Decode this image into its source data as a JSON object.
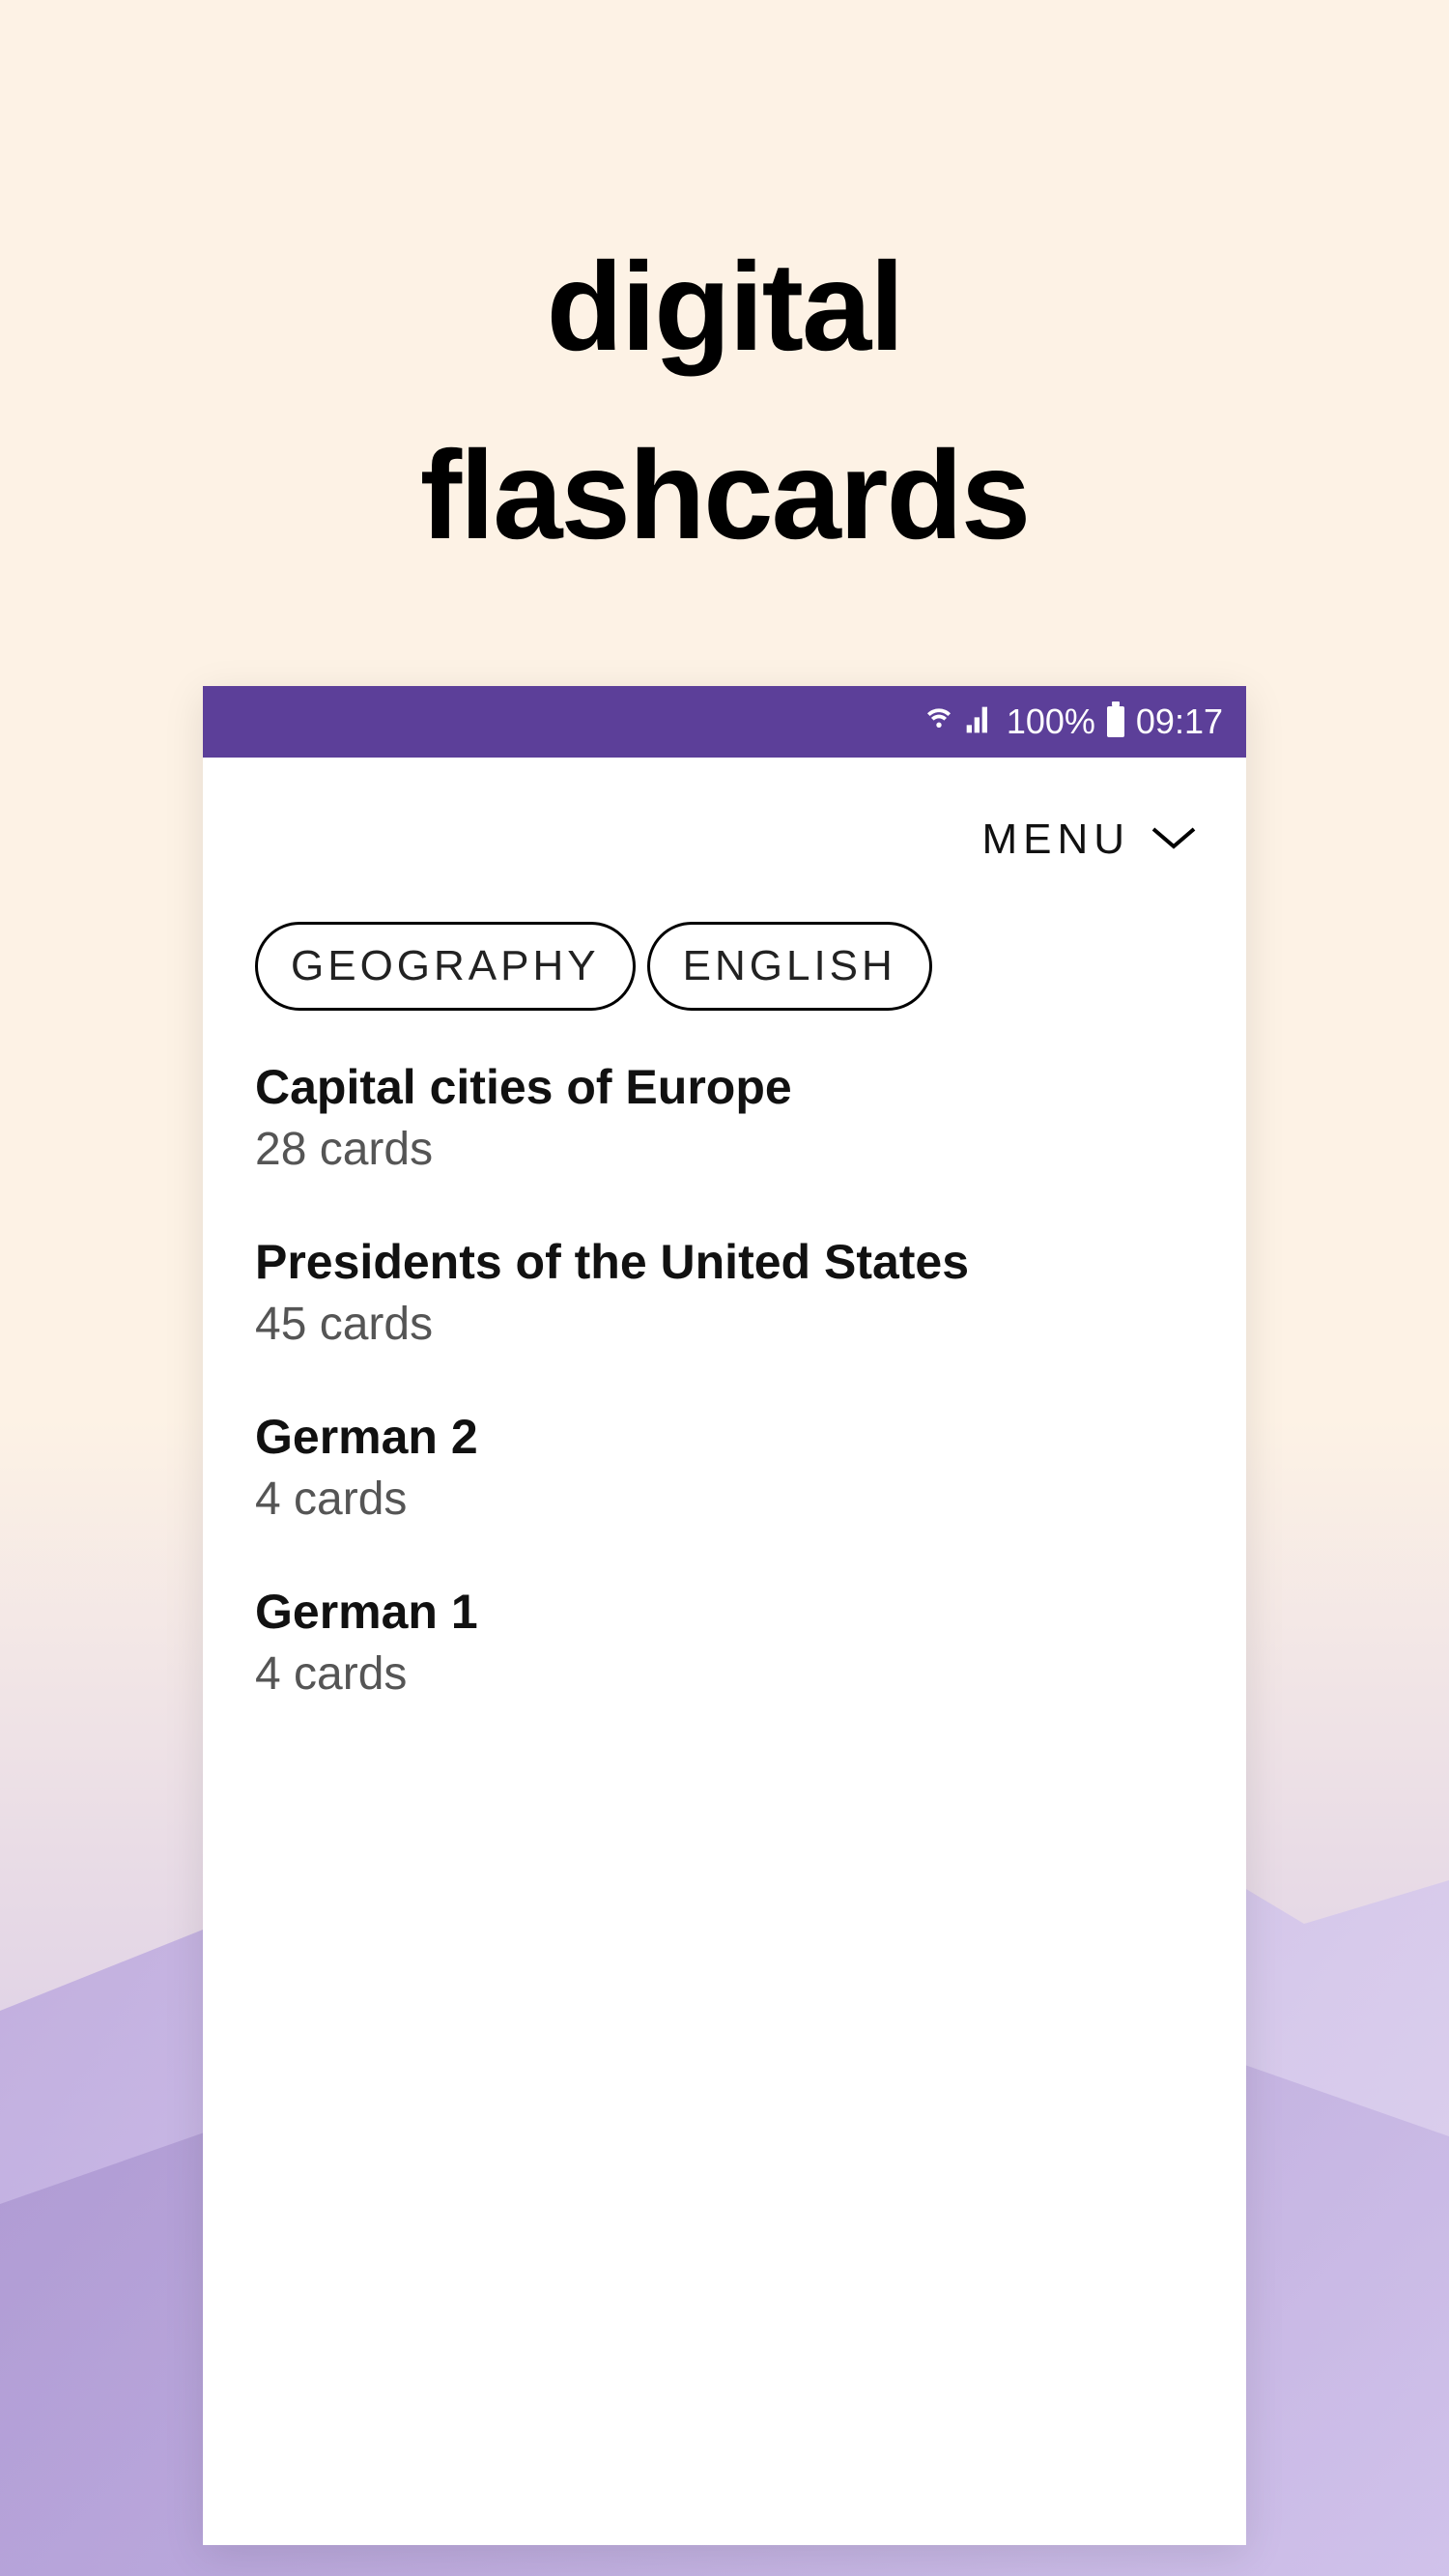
{
  "header": {
    "title_line1": "digital",
    "title_line2": "flashcards"
  },
  "status_bar": {
    "battery_percent": "100%",
    "time": "09:17"
  },
  "app": {
    "menu_label": "MENU",
    "chips": [
      {
        "label": "GEOGRAPHY"
      },
      {
        "label": "ENGLISH"
      }
    ],
    "decks": [
      {
        "title": "Capital cities of Europe",
        "count": "28 cards"
      },
      {
        "title": "Presidents of the United States",
        "count": "45 cards"
      },
      {
        "title": "German 2",
        "count": "4 cards"
      },
      {
        "title": "German 1",
        "count": "4 cards"
      }
    ]
  }
}
